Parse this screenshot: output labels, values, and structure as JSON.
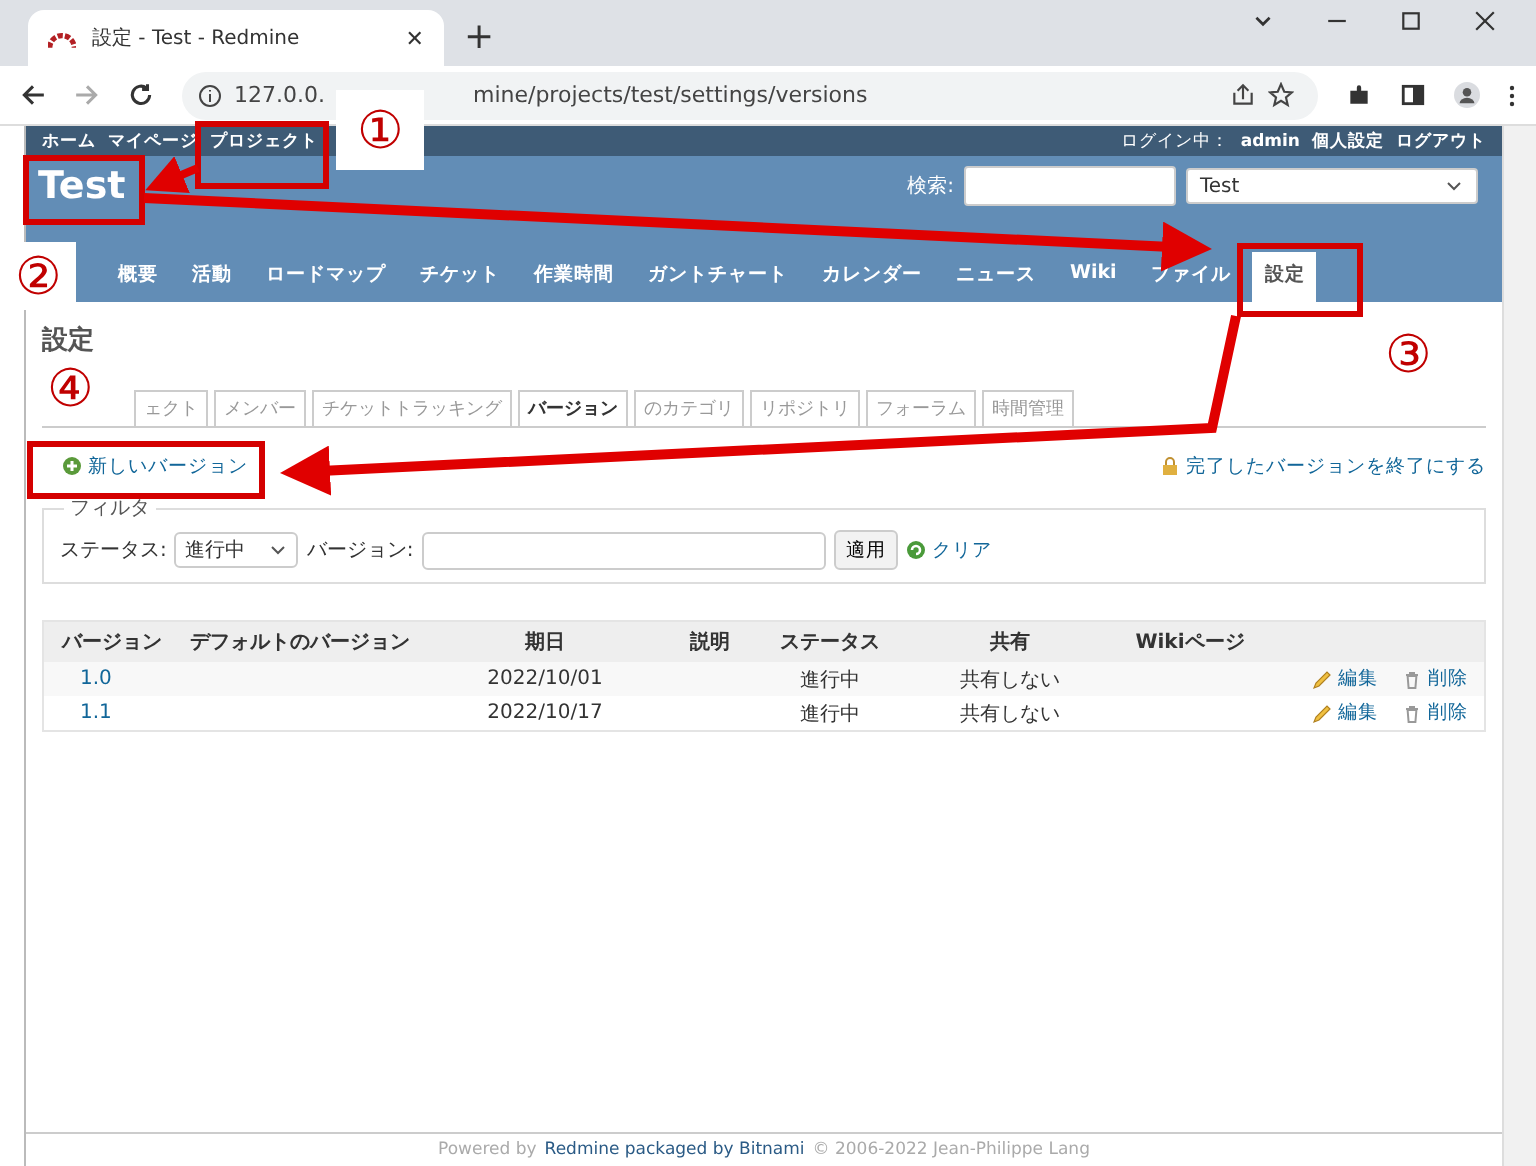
{
  "browser": {
    "tab_title": "設定 - Test - Redmine",
    "close_tab": "✕",
    "new_tab": "+",
    "url_start": "127.0.0.",
    "url_end": "mine/projects/test/settings/versions"
  },
  "top_menu": [
    "ホーム",
    "マイページ",
    "プロジェクト"
  ],
  "account": {
    "logged_in": "ログイン中：",
    "user": "admin",
    "links": [
      "個人設定",
      "ログアウト"
    ]
  },
  "project": {
    "title": "Test",
    "search_label": "検索:",
    "jump": "Test"
  },
  "main_menu": [
    {
      "label": "概要",
      "selected": false
    },
    {
      "label": "活動",
      "selected": false
    },
    {
      "label": "ロードマップ",
      "selected": false
    },
    {
      "label": "チケット",
      "selected": false
    },
    {
      "label": "作業時間",
      "selected": false
    },
    {
      "label": "ガントチャート",
      "selected": false
    },
    {
      "label": "カレンダー",
      "selected": false
    },
    {
      "label": "ニュース",
      "selected": false
    },
    {
      "label": "Wiki",
      "selected": false
    },
    {
      "label": "ファイル",
      "selected": false
    },
    {
      "label": "設定",
      "selected": true
    }
  ],
  "heading": "設定",
  "settings_tabs": [
    {
      "label": "ェクト",
      "selected": false
    },
    {
      "label": "メンバー",
      "selected": false
    },
    {
      "label": "チケットトラッキング",
      "selected": false
    },
    {
      "label": "バージョン",
      "selected": true
    },
    {
      "label": "のカテゴリ",
      "selected": false
    },
    {
      "label": "リポジトリ",
      "selected": false
    },
    {
      "label": "フォーラム",
      "selected": false
    },
    {
      "label": "時間管理",
      "selected": false
    }
  ],
  "new_version": "新しいバージョン",
  "close_completed": "完了したバージョンを終了にする",
  "filter": {
    "legend": "フィルタ",
    "status_label": "ステータス:",
    "status": "進行中",
    "version_label": "バージョン:",
    "apply": "適用",
    "clear": "クリア"
  },
  "table": {
    "columns": [
      "バージョン",
      "デフォルトのバージョン",
      "期日",
      "説明",
      "ステータス",
      "共有",
      "Wikiページ"
    ],
    "rows": [
      {
        "version": "1.0",
        "date": "2022/10/01",
        "status": "進行中",
        "sharing": "共有しない",
        "edit": "編集",
        "delete": "削除"
      },
      {
        "version": "1.1",
        "date": "2022/10/17",
        "status": "進行中",
        "sharing": "共有しない",
        "edit": "編集",
        "delete": "削除"
      }
    ]
  },
  "footer": {
    "prefix": "Powered by",
    "link": "Redmine packaged by Bitnami",
    "suffix": "© 2006-2022 Jean-Philippe Lang"
  },
  "annotations": [
    "①",
    "②",
    "③",
    "④"
  ]
}
